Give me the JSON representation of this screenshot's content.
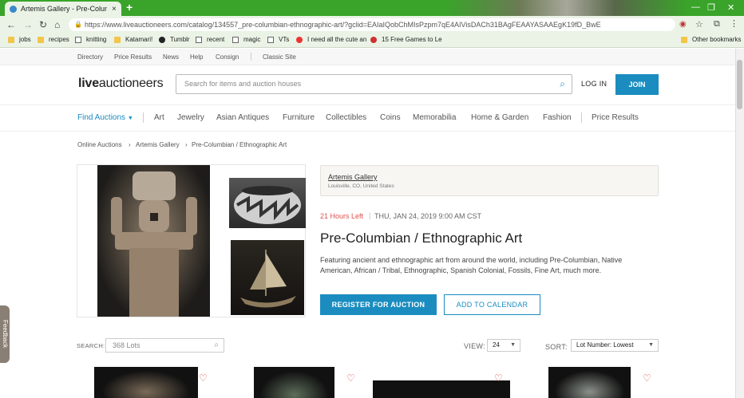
{
  "browser": {
    "tab_title": "Artemis Gallery - Pre-Columbian",
    "tab_close": "×",
    "new_tab": "+",
    "url": "https://www.liveauctioneers.com/catalog/134557_pre-columbian-ethnographic-art/?gclid=EAIaIQobChMIsPzpm7qE4AIVisDACh31BAgFEAAYASAAEgK19fD_BwE",
    "nav": {
      "back": "←",
      "forward": "→",
      "reload": "↻",
      "home": "⌂"
    },
    "window_controls": {
      "minimize": "—",
      "maximize": "❐",
      "close": "✕"
    },
    "bookmarks": [
      {
        "label": "jobs",
        "icon": "folder-icon"
      },
      {
        "label": "recipes",
        "icon": "folder-icon"
      },
      {
        "label": "knitting",
        "icon": "page-icon"
      },
      {
        "label": "Katamari!",
        "icon": "folder-icon"
      },
      {
        "label": "Tumblr",
        "icon": "tumblr-icon"
      },
      {
        "label": "recent",
        "icon": "page-icon"
      },
      {
        "label": "magic",
        "icon": "page-icon"
      },
      {
        "label": "VTs",
        "icon": "page-icon"
      },
      {
        "label": "I need all the cute an",
        "icon": "youtube-icon"
      },
      {
        "label": "15 Free Games to Le",
        "icon": "site-icon"
      }
    ],
    "other_bookmarks": "Other bookmarks"
  },
  "topnav": [
    "Directory",
    "Price Results",
    "News",
    "Help",
    "Consign",
    "Classic Site"
  ],
  "header": {
    "logo_light": "live",
    "logo_bold": "auctioneers",
    "search_placeholder": "Search for items and auction houses",
    "login": "LOG IN",
    "join": "JOIN"
  },
  "categories": {
    "find": "Find Auctions",
    "items": [
      "Art",
      "Jewelry",
      "Asian Antiques",
      "Furniture",
      "Collectibles",
      "Coins",
      "Memorabilia",
      "Home & Garden",
      "Fashion"
    ],
    "price_results": "Price Results"
  },
  "breadcrumb": [
    "Online Auctions",
    "Artemis Gallery",
    "Pre-Columbian / Ethnographic Art"
  ],
  "auction": {
    "seller": "Artemis Gallery",
    "location": "Louisville, CO, United States",
    "time_left": "21 Hours Left",
    "datetime": "THU, JAN 24, 2019 9:00 AM CST",
    "title": "Pre-Columbian / Ethnographic Art",
    "description": "Featuring ancient and ethnographic art from around the world, including Pre-Columbian, Native American, African / Tribal, Ethnographic, Spanish Colonial, Fossils, Fine Art, much more.",
    "register": "REGISTER FOR AUCTION",
    "calendar": "ADD TO CALENDAR"
  },
  "lots": {
    "search_label": "SEARCH:",
    "search_placeholder": "368 Lots",
    "view_label": "VIEW:",
    "view_value": "24",
    "sort_label": "SORT:",
    "sort_value": "Lot Number: Lowest"
  },
  "feedback": "Feedback"
}
